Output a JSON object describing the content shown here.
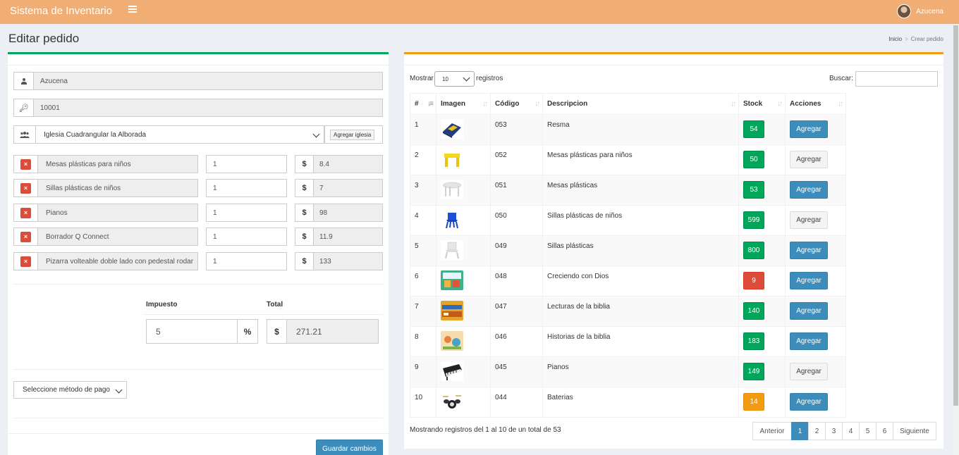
{
  "header": {
    "app_title": "Sistema de Inventario",
    "user_name": "Azucena"
  },
  "page": {
    "title": "Editar pedido",
    "breadcrumb": [
      "Inicio",
      "Crear pedido"
    ]
  },
  "form": {
    "seller": "Azucena",
    "code": "10001",
    "client": "Iglesia Cuadrangular la Alborada",
    "add_client_label": "Agregar iglesia",
    "products": [
      {
        "name": "Mesas plásticas para niños",
        "qty": "1",
        "price": "8.4"
      },
      {
        "name": "Sillas plásticas de niños",
        "qty": "1",
        "price": "7"
      },
      {
        "name": "Pianos",
        "qty": "1",
        "price": "98"
      },
      {
        "name": "Borrador Q Connect",
        "qty": "1",
        "price": "11.9"
      },
      {
        "name": "Pizarra volteable doble lado con pedestal rodar",
        "qty": "1",
        "price": "133"
      }
    ],
    "currency_symbol": "$",
    "remove_symbol": "×",
    "tax_label": "Impuesto",
    "tax_value": "5",
    "percent_symbol": "%",
    "total_label": "Total",
    "total_value": "271.21",
    "payment_placeholder": "Seleccione método de pago",
    "save_label": "Guardar cambios"
  },
  "table": {
    "length_label_before": "Mostrar",
    "length_value": "10",
    "length_label_after": "registros",
    "search_label": "Buscar:",
    "columns": [
      "#",
      "Imagen",
      "Código",
      "Descripcion",
      "Stock",
      "Acciones"
    ],
    "rows": [
      {
        "num": "1",
        "code": "053",
        "desc": "Resma",
        "stock": "54",
        "stock_color": "green",
        "action": "Agregar",
        "action_active": true,
        "thumb": "resma"
      },
      {
        "num": "2",
        "code": "052",
        "desc": "Mesas plásticas para niños",
        "stock": "50",
        "stock_color": "green",
        "action": "Agregar",
        "action_active": false,
        "thumb": "mesa-amarilla"
      },
      {
        "num": "3",
        "code": "051",
        "desc": "Mesas plásticas",
        "stock": "53",
        "stock_color": "green",
        "action": "Agregar",
        "action_active": true,
        "thumb": "mesa-blanca"
      },
      {
        "num": "4",
        "code": "050",
        "desc": "Sillas plásticas de niños",
        "stock": "599",
        "stock_color": "green",
        "action": "Agregar",
        "action_active": false,
        "thumb": "silla-azul"
      },
      {
        "num": "5",
        "code": "049",
        "desc": "Sillas plásticas",
        "stock": "800",
        "stock_color": "green",
        "action": "Agregar",
        "action_active": true,
        "thumb": "silla-blanca"
      },
      {
        "num": "6",
        "code": "048",
        "desc": "Creciendo con Dios",
        "stock": "9",
        "stock_color": "red",
        "action": "Agregar",
        "action_active": true,
        "thumb": "libro-creciendo"
      },
      {
        "num": "7",
        "code": "047",
        "desc": "Lecturas de la biblia",
        "stock": "140",
        "stock_color": "green",
        "action": "Agregar",
        "action_active": true,
        "thumb": "libro-lecturas"
      },
      {
        "num": "8",
        "code": "046",
        "desc": "Historias de la biblia",
        "stock": "183",
        "stock_color": "green",
        "action": "Agregar",
        "action_active": true,
        "thumb": "libro-historias"
      },
      {
        "num": "9",
        "code": "045",
        "desc": "Pianos",
        "stock": "149",
        "stock_color": "green",
        "action": "Agregar",
        "action_active": false,
        "thumb": "piano"
      },
      {
        "num": "10",
        "code": "044",
        "desc": "Baterias",
        "stock": "14",
        "stock_color": "orange",
        "action": "Agregar",
        "action_active": true,
        "thumb": "bateria"
      }
    ],
    "info": "Mostrando registros del 1 al 10 de un total de 53",
    "pagination": [
      "Anterior",
      "1",
      "2",
      "3",
      "4",
      "5",
      "6",
      "Siguiente"
    ],
    "current_page": "1"
  },
  "colors": {
    "header": "#f0ad74",
    "primary": "#3c8dbc",
    "success": "#00a65a",
    "danger": "#dd4b39",
    "warning": "#f39c12"
  }
}
